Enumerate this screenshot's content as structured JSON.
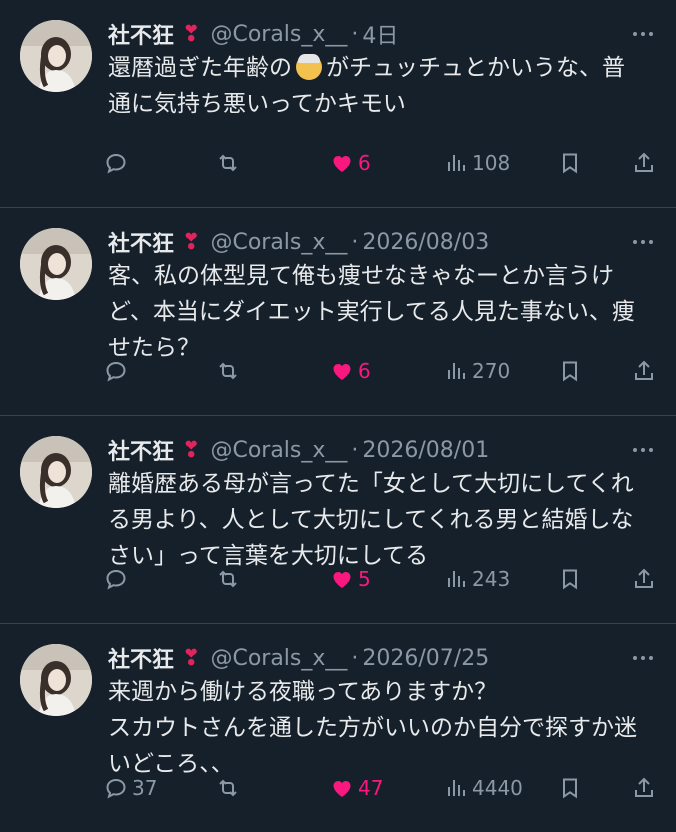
{
  "colors": {
    "background": "#15202b",
    "like_active": "#f91880",
    "muted": "#8b98a5"
  },
  "tweets": [
    {
      "name": "社不狂",
      "handle": "@Corals_x__",
      "separator": "·",
      "date": "4日",
      "lines": [
        "還暦過ぎた年齢の",
        "がチュッチュとかいうな、普",
        "通に気持ち悪いってかキモい"
      ],
      "inline_emoji": "older-person-emoji",
      "replies": "",
      "likes": "6",
      "views": "108"
    },
    {
      "name": "社不狂",
      "handle": "@Corals_x__",
      "separator": "·",
      "date": "2026/08/03",
      "lines": [
        "客、私の体型見て俺も痩せなきゃなーとか言うけ",
        "ど、本当にダイエット実行してる人見た事ない、痩",
        "せたら？"
      ],
      "replies": "",
      "likes": "6",
      "views": "270"
    },
    {
      "name": "社不狂",
      "handle": "@Corals_x__",
      "separator": "·",
      "date": "2026/08/01",
      "lines": [
        "離婚歴ある母が言ってた「女として大切にしてくれ",
        "る男より、人として大切にしてくれる男と結婚しな",
        "さい」って言葉を大切にしてる"
      ],
      "replies": "",
      "likes": "5",
      "views": "243"
    },
    {
      "name": "社不狂",
      "handle": "@Corals_x__",
      "separator": "·",
      "date": "2026/07/25",
      "lines": [
        "来週から働ける夜職ってありますか？",
        "スカウトさんを通した方がいいのか自分で探すか迷",
        "いどころ、、"
      ],
      "replies": "37",
      "likes": "47",
      "views": "4440"
    }
  ]
}
